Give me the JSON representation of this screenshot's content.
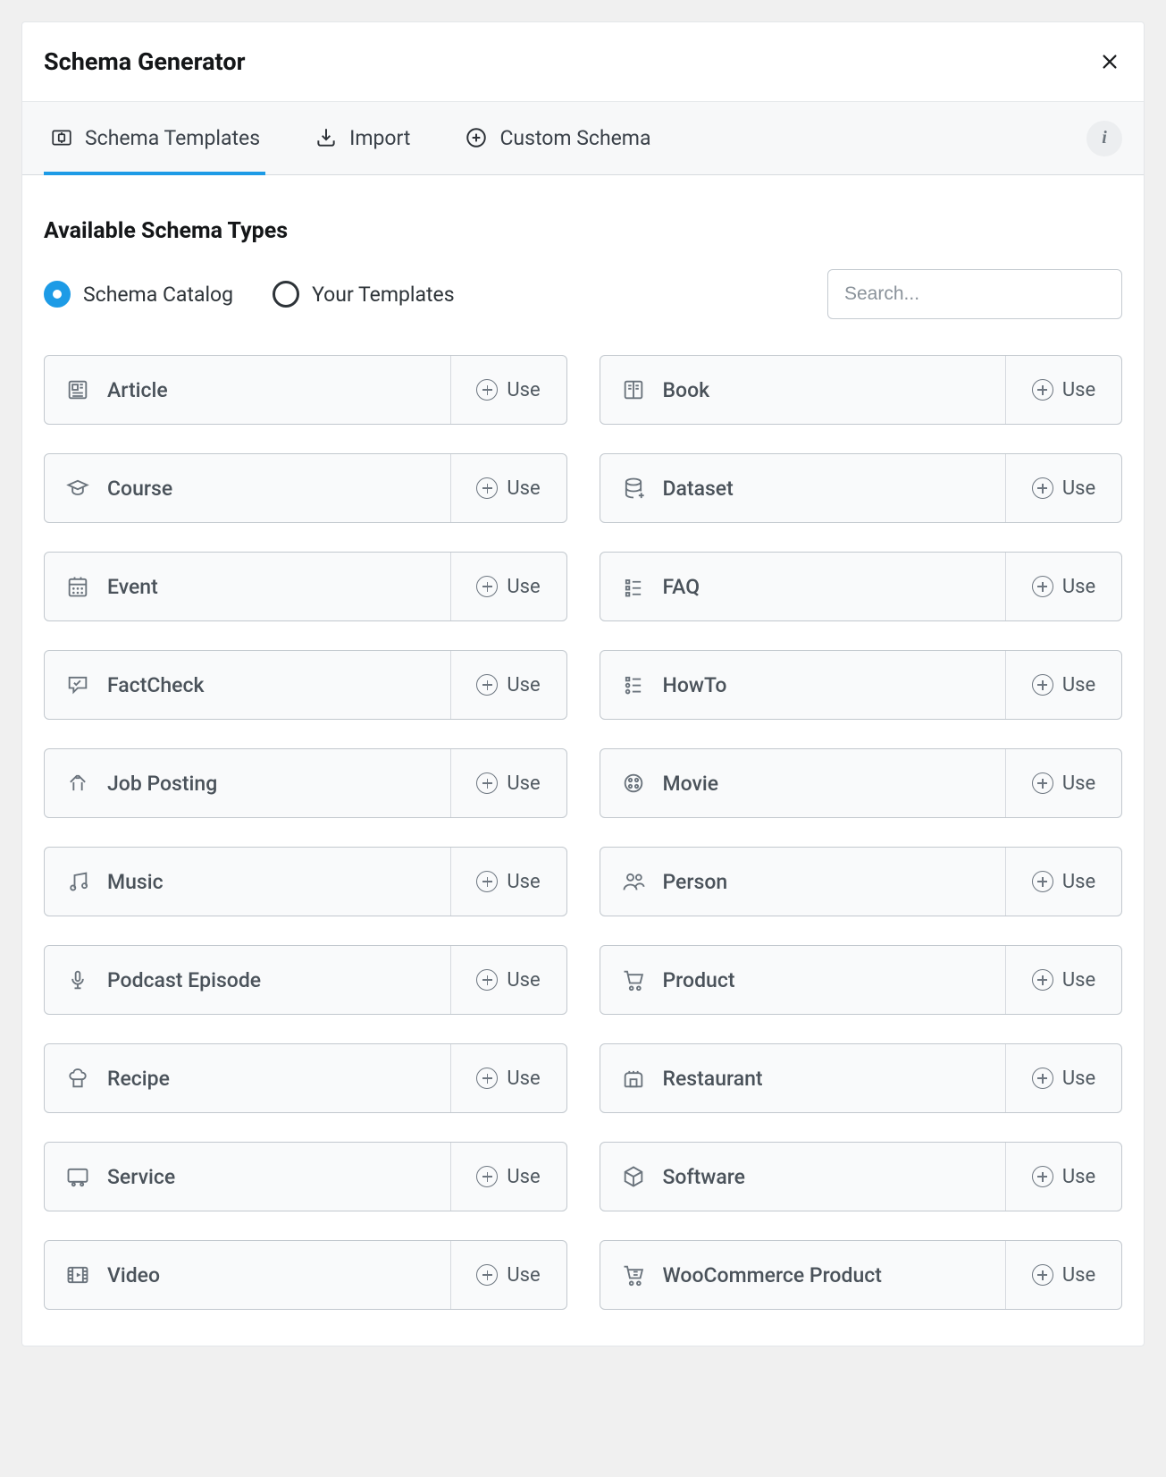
{
  "header": {
    "title": "Schema Generator"
  },
  "tabs": {
    "templates": "Schema Templates",
    "import": "Import",
    "custom": "Custom Schema"
  },
  "section": {
    "title": "Available Schema Types"
  },
  "filter": {
    "catalog": "Schema Catalog",
    "your": "Your Templates"
  },
  "search": {
    "placeholder": "Search..."
  },
  "use_label": "Use",
  "types": [
    "Article",
    "Book",
    "Course",
    "Dataset",
    "Event",
    "FAQ",
    "FactCheck",
    "HowTo",
    "Job Posting",
    "Movie",
    "Music",
    "Person",
    "Podcast Episode",
    "Product",
    "Recipe",
    "Restaurant",
    "Service",
    "Software",
    "Video",
    "WooCommerce Product"
  ]
}
